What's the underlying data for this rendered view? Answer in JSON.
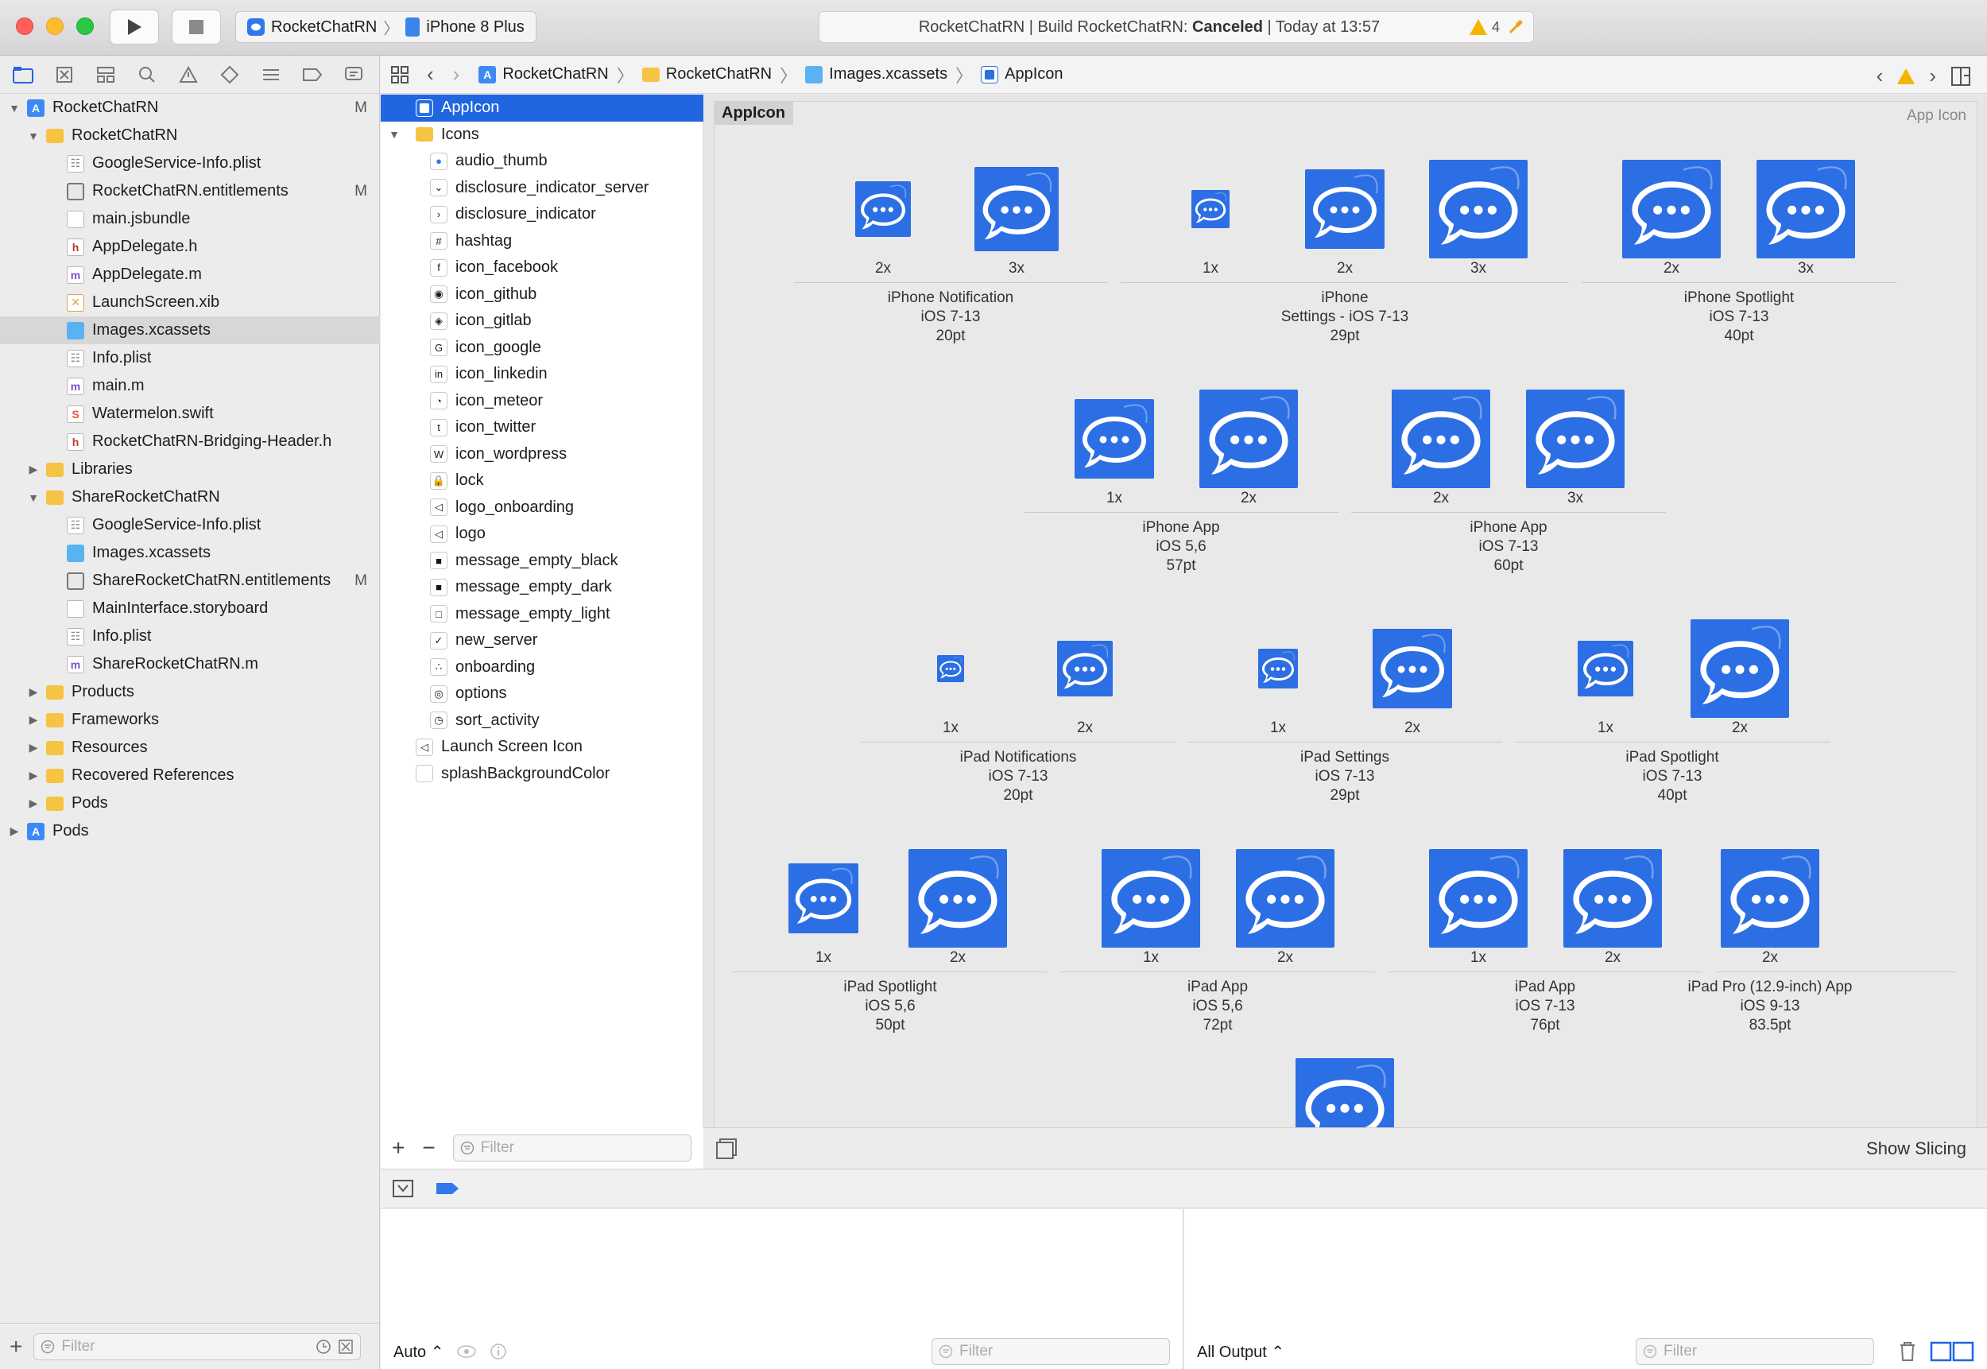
{
  "toolbar": {
    "scheme_target": "RocketChatRN",
    "scheme_device": "iPhone 8 Plus",
    "activity_prefix": "RocketChatRN | Build RocketChatRN: ",
    "activity_status": "Canceled",
    "activity_suffix": " | Today at 13:57",
    "warning_count": "4"
  },
  "navigator": {
    "items": [
      {
        "label": "RocketChatRN",
        "badge": "M"
      },
      {
        "label": "RocketChatRN",
        "badge": ""
      },
      {
        "label": "GoogleService-Info.plist",
        "badge": ""
      },
      {
        "label": "RocketChatRN.entitlements",
        "badge": "M"
      },
      {
        "label": "main.jsbundle",
        "badge": ""
      },
      {
        "label": "AppDelegate.h",
        "badge": ""
      },
      {
        "label": "AppDelegate.m",
        "badge": ""
      },
      {
        "label": "LaunchScreen.xib",
        "badge": ""
      },
      {
        "label": "Images.xcassets",
        "badge": ""
      },
      {
        "label": "Info.plist",
        "badge": ""
      },
      {
        "label": "main.m",
        "badge": ""
      },
      {
        "label": "Watermelon.swift",
        "badge": ""
      },
      {
        "label": "RocketChatRN-Bridging-Header.h",
        "badge": ""
      },
      {
        "label": "Libraries",
        "badge": ""
      },
      {
        "label": "ShareRocketChatRN",
        "badge": ""
      },
      {
        "label": "GoogleService-Info.plist",
        "badge": ""
      },
      {
        "label": "Images.xcassets",
        "badge": ""
      },
      {
        "label": "ShareRocketChatRN.entitlements",
        "badge": "M"
      },
      {
        "label": "MainInterface.storyboard",
        "badge": ""
      },
      {
        "label": "Info.plist",
        "badge": ""
      },
      {
        "label": "ShareRocketChatRN.m",
        "badge": ""
      },
      {
        "label": "Products",
        "badge": ""
      },
      {
        "label": "Frameworks",
        "badge": ""
      },
      {
        "label": "Resources",
        "badge": ""
      },
      {
        "label": "Recovered References",
        "badge": ""
      },
      {
        "label": "Pods",
        "badge": ""
      },
      {
        "label": "Pods",
        "badge": ""
      }
    ],
    "filter_placeholder": "Filter"
  },
  "jumpbar": {
    "crumbs": [
      "RocketChatRN",
      "RocketChatRN",
      "Images.xcassets",
      "AppIcon"
    ]
  },
  "assets": {
    "items": [
      "AppIcon",
      "Icons",
      "audio_thumb",
      "disclosure_indicator_server",
      "disclosure_indicator",
      "hashtag",
      "icon_facebook",
      "icon_github",
      "icon_gitlab",
      "icon_google",
      "icon_linkedin",
      "icon_meteor",
      "icon_twitter",
      "icon_wordpress",
      "lock",
      "logo_onboarding",
      "logo",
      "message_empty_black",
      "message_empty_dark",
      "message_empty_light",
      "new_server",
      "onboarding",
      "options",
      "sort_activity",
      "Launch Screen Icon",
      "splashBackgroundColor"
    ],
    "filter_placeholder": "Filter"
  },
  "iconset": {
    "title": "AppIcon",
    "type": "App Icon",
    "groups": [
      {
        "l1": "iPhone Notification",
        "l2": "iOS 7-13",
        "l3": "20pt",
        "scales": [
          "2x",
          "3x"
        ]
      },
      {
        "l1": "iPhone",
        "l2": "Settings - iOS 7-13",
        "l3": "29pt",
        "scales": [
          "1x",
          "2x",
          "3x"
        ]
      },
      {
        "l1": "iPhone Spotlight",
        "l2": "iOS 7-13",
        "l3": "40pt",
        "scales": [
          "2x",
          "3x"
        ]
      },
      {
        "l1": "iPhone App",
        "l2": "iOS 5,6",
        "l3": "57pt",
        "scales": [
          "1x",
          "2x"
        ]
      },
      {
        "l1": "iPhone App",
        "l2": "iOS 7-13",
        "l3": "60pt",
        "scales": [
          "2x",
          "3x"
        ]
      },
      {
        "l1": "iPad Notifications",
        "l2": "iOS 7-13",
        "l3": "20pt",
        "scales": [
          "1x",
          "2x"
        ]
      },
      {
        "l1": "iPad Settings",
        "l2": "iOS 7-13",
        "l3": "29pt",
        "scales": [
          "1x",
          "2x"
        ]
      },
      {
        "l1": "iPad Spotlight",
        "l2": "iOS 7-13",
        "l3": "40pt",
        "scales": [
          "1x",
          "2x"
        ]
      },
      {
        "l1": "iPad Spotlight",
        "l2": "iOS 5,6",
        "l3": "50pt",
        "scales": [
          "1x",
          "2x"
        ]
      },
      {
        "l1": "iPad App",
        "l2": "iOS 5,6",
        "l3": "72pt",
        "scales": [
          "1x",
          "2x"
        ]
      },
      {
        "l1": "iPad App",
        "l2": "iOS 7-13",
        "l3": "76pt",
        "scales": [
          "1x",
          "2x"
        ]
      },
      {
        "l1": "iPad Pro (12.9-inch) App",
        "l2": "iOS 9-13",
        "l3": "83.5pt",
        "scales": [
          "2x"
        ]
      }
    ],
    "show_slicing": "Show Slicing",
    "accent": "#2c6ee4"
  },
  "debug": {
    "auto_label": "Auto",
    "output_label": "All Output",
    "filter_placeholder": "Filter"
  }
}
